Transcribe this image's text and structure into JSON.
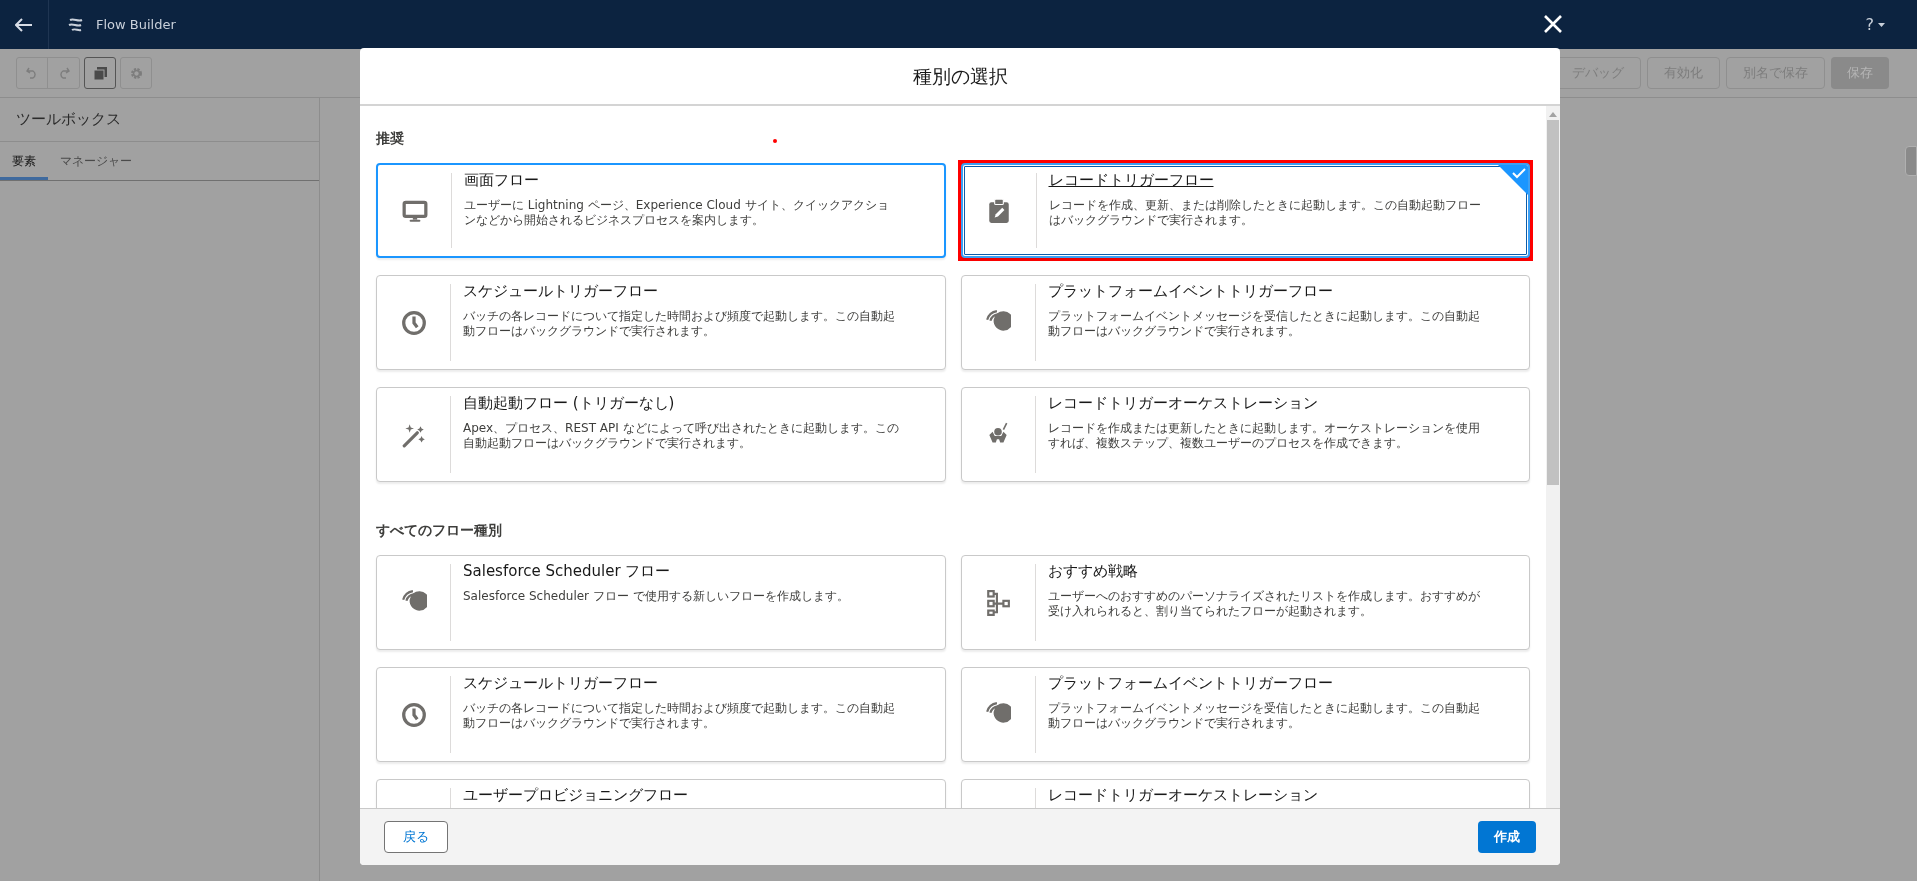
{
  "header": {
    "title": "Flow Builder",
    "help": "?"
  },
  "toolbar": {
    "buttons": [
      {
        "label": "デバッグ",
        "kind": "outline"
      },
      {
        "label": "有効化",
        "kind": "outline"
      },
      {
        "label": "別名で保存",
        "kind": "outline"
      },
      {
        "label": "保存",
        "kind": "primary"
      }
    ]
  },
  "toolbox": {
    "title": "ツールボックス",
    "tabs": [
      {
        "label": "要素",
        "selected": true
      },
      {
        "label": "マネージャー",
        "selected": false
      }
    ]
  },
  "modal": {
    "title": "種別の選択",
    "sections": [
      {
        "heading": "推奨",
        "cards": [
          {
            "kind": "screen",
            "title": "画面フロー",
            "description": "ユーザーに Lightning ページ、Experience Cloud サイト、クイックアクションなどから開始されるビジネスプロセスを案内します。",
            "selected": false,
            "focused": true
          },
          {
            "kind": "record",
            "title": "レコードトリガーフロー",
            "description": "レコードを作成、更新、または削除したときに起動します。この自動起動フローはバックグラウンドで実行されます。",
            "selected": true,
            "focused": false
          },
          {
            "kind": "schedule",
            "title": "スケジュールトリガーフロー",
            "description": "バッチの各レコードについて指定した時間および頻度で起動します。この自動起動フローはバックグラウンドで実行されます。",
            "selected": false,
            "focused": false
          },
          {
            "kind": "event",
            "title": "プラットフォームイベントトリガーフロー",
            "description": "プラットフォームイベントメッセージを受信したときに起動します。この自動起動フローはバックグラウンドで実行されます。",
            "selected": false,
            "focused": false
          },
          {
            "kind": "autolaunched",
            "title": "自動起動フロー (トリガーなし)",
            "description": "Apex、プロセス、REST API などによって呼び出されたときに起動します。この自動起動フローはバックグラウンドで実行されます。",
            "selected": false,
            "focused": false
          },
          {
            "kind": "orchestration",
            "title": "レコードトリガーオーケストレーション",
            "description": "レコードを作成または更新したときに起動します。オーケストレーションを使用すれば、複数ステップ、複数ユーザーのプロセスを作成できます。",
            "selected": false,
            "focused": false
          }
        ]
      },
      {
        "heading": "すべてのフロー種別",
        "cards": [
          {
            "kind": "event",
            "title": "Salesforce Scheduler フロー",
            "description": "Salesforce Scheduler フロー で使用する新しいフローを作成します。",
            "selected": false,
            "focused": false
          },
          {
            "kind": "strategy",
            "title": "おすすめ戦略",
            "description": "ユーザーへのおすすめのパーソナライズされたリストを作成します。おすすめが受け入れられると、割り当てられたフローが起動されます。",
            "selected": false,
            "focused": false
          },
          {
            "kind": "schedule",
            "title": "スケジュールトリガーフロー",
            "description": "バッチの各レコードについて指定した時間および頻度で起動します。この自動起動フローはバックグラウンドで実行されます。",
            "selected": false,
            "focused": false
          },
          {
            "kind": "event",
            "title": "プラットフォームイベントトリガーフロー",
            "description": "プラットフォームイベントメッセージを受信したときに起動します。この自動起動フローはバックグラウンドで実行されます。",
            "selected": false,
            "focused": false
          },
          {
            "kind": "partial",
            "title": "ユーザープロビジョニングフロー",
            "selected": false,
            "focused": false
          },
          {
            "kind": "partial",
            "title": "レコードトリガーオーケストレーション",
            "selected": false,
            "focused": false
          }
        ]
      }
    ],
    "back_button": "戻る",
    "create_button": "作成"
  }
}
